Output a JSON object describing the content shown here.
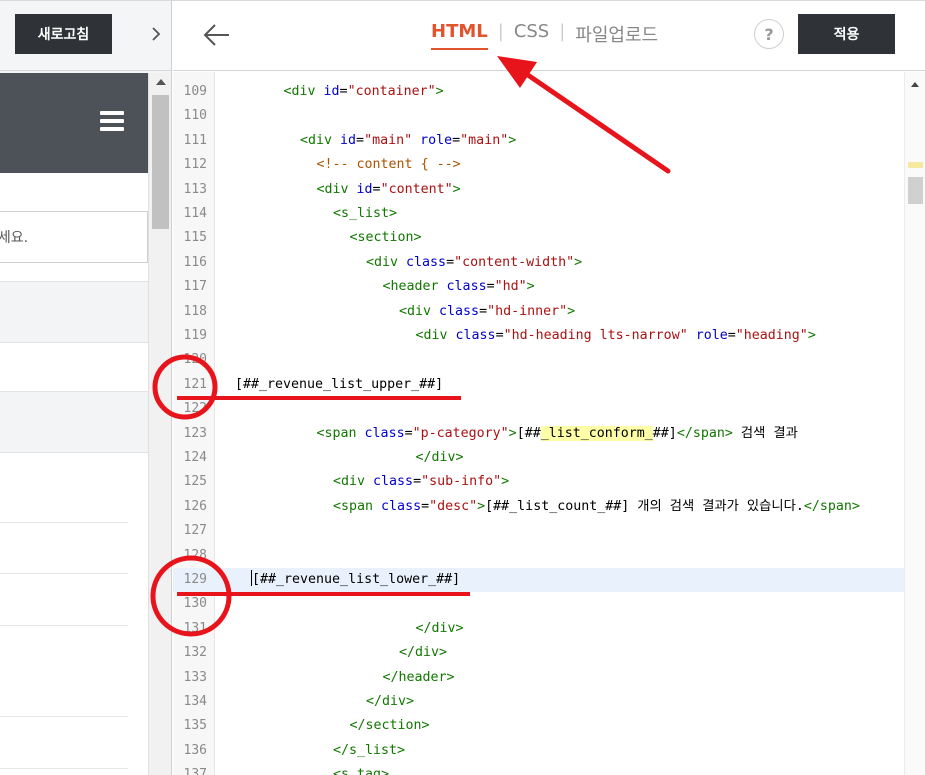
{
  "left_panel": {
    "refresh_label": "새로고침",
    "collapse_icon": "chevron-right-icon",
    "preview": {
      "menu_icon": "hamburger-menu-icon",
      "search_placeholder_fragment": "르세요."
    }
  },
  "toolbar": {
    "back_icon": "arrow-left-icon",
    "tabs": [
      {
        "label": "HTML",
        "active": true
      },
      {
        "label": "CSS",
        "active": false
      },
      {
        "label": "파일업로드",
        "active": false
      }
    ],
    "help_label": "?",
    "apply_label": "적용"
  },
  "colors": {
    "accent": "#e2542e",
    "annotation_red": "#e8141c",
    "dark_button": "#2f3237",
    "preview_header": "#4c5258"
  },
  "editor": {
    "active_line": 129,
    "lines": [
      {
        "n": "109",
        "indent": 1,
        "tokens": [
          [
            "tg",
            "<div "
          ],
          [
            "at",
            "id"
          ],
          [
            "p",
            "="
          ],
          [
            "vl",
            "\"container\""
          ],
          [
            "tg",
            ">"
          ]
        ]
      },
      {
        "n": "110",
        "indent": 0,
        "tokens": []
      },
      {
        "n": "111",
        "indent": 2,
        "tokens": [
          [
            "tg",
            "<div "
          ],
          [
            "at",
            "id"
          ],
          [
            "p",
            "="
          ],
          [
            "vl",
            "\"main\""
          ],
          [
            "p",
            " "
          ],
          [
            "at",
            "role"
          ],
          [
            "p",
            "="
          ],
          [
            "vl",
            "\"main\""
          ],
          [
            "tg",
            ">"
          ]
        ]
      },
      {
        "n": "112",
        "indent": 3,
        "tokens": [
          [
            "cm",
            "<!-- content { -->"
          ]
        ]
      },
      {
        "n": "113",
        "indent": 3,
        "tokens": [
          [
            "tg",
            "<div "
          ],
          [
            "at",
            "id"
          ],
          [
            "p",
            "="
          ],
          [
            "vl",
            "\"content\""
          ],
          [
            "tg",
            ">"
          ]
        ]
      },
      {
        "n": "114",
        "indent": 4,
        "tokens": [
          [
            "tg",
            "<s_list>"
          ]
        ]
      },
      {
        "n": "115",
        "indent": 5,
        "tokens": [
          [
            "tg",
            "<section>"
          ]
        ]
      },
      {
        "n": "116",
        "indent": 6,
        "tokens": [
          [
            "tg",
            "<div "
          ],
          [
            "at",
            "class"
          ],
          [
            "p",
            "="
          ],
          [
            "vl",
            "\"content-width\""
          ],
          [
            "tg",
            ">"
          ]
        ]
      },
      {
        "n": "117",
        "indent": 7,
        "tokens": [
          [
            "tg",
            "<header "
          ],
          [
            "at",
            "class"
          ],
          [
            "p",
            "="
          ],
          [
            "vl",
            "\"hd\""
          ],
          [
            "tg",
            ">"
          ]
        ]
      },
      {
        "n": "118",
        "indent": 8,
        "tokens": [
          [
            "tg",
            "<div "
          ],
          [
            "at",
            "class"
          ],
          [
            "p",
            "="
          ],
          [
            "vl",
            "\"hd-inner\""
          ],
          [
            "tg",
            ">"
          ]
        ]
      },
      {
        "n": "119",
        "indent": 9,
        "tokens": [
          [
            "tg",
            "<div "
          ],
          [
            "at",
            "class"
          ],
          [
            "p",
            "="
          ],
          [
            "vl",
            "\"hd-heading lts-narrow\""
          ],
          [
            "p",
            " "
          ],
          [
            "at",
            "role"
          ],
          [
            "p",
            "="
          ],
          [
            "vl",
            "\"heading\""
          ],
          [
            "tg",
            ">"
          ]
        ]
      },
      {
        "n": "120",
        "indent": 0,
        "tokens": []
      },
      {
        "n": "121",
        "indent": -1,
        "tokens": [
          [
            "p",
            "[##_revenue_list_upper_##]"
          ]
        ]
      },
      {
        "n": "122",
        "indent": 0,
        "tokens": []
      },
      {
        "n": "123",
        "indent": 3,
        "tokens": [
          [
            "tg",
            "<span "
          ],
          [
            "at",
            "class"
          ],
          [
            "p",
            "="
          ],
          [
            "vl",
            "\"p-category\""
          ],
          [
            "tg",
            ">"
          ],
          [
            "p",
            "[##"
          ],
          [
            "hl",
            "_list_conform_"
          ],
          [
            "p",
            "##]"
          ],
          [
            "tg",
            "</span>"
          ],
          [
            "p",
            " 검색 결과"
          ]
        ]
      },
      {
        "n": "124",
        "indent": 9,
        "tokens": [
          [
            "tg",
            "</div>"
          ]
        ]
      },
      {
        "n": "125",
        "indent": 4,
        "tokens": [
          [
            "tg",
            "<div "
          ],
          [
            "at",
            "class"
          ],
          [
            "p",
            "="
          ],
          [
            "vl",
            "\"sub-info\""
          ],
          [
            "tg",
            ">"
          ]
        ]
      },
      {
        "n": "126",
        "indent": 4,
        "tokens": [
          [
            "tg",
            "<span "
          ],
          [
            "at",
            "class"
          ],
          [
            "p",
            "="
          ],
          [
            "vl",
            "\"desc\""
          ],
          [
            "tg",
            ">"
          ],
          [
            "p",
            "[##_list_count_##] 개의 검색 결과가 있습니다."
          ],
          [
            "tg",
            "</span>"
          ]
        ]
      },
      {
        "n": "127",
        "indent": 0,
        "tokens": []
      },
      {
        "n": "128",
        "indent": 0,
        "tokens": []
      },
      {
        "n": "129",
        "indent": -2,
        "tokens": [
          [
            "cur",
            ""
          ],
          [
            "p",
            "[##_revenue_list_lower_##]"
          ]
        ]
      },
      {
        "n": "130",
        "indent": 0,
        "tokens": []
      },
      {
        "n": "131",
        "indent": 9,
        "tokens": [
          [
            "tg",
            "</div>"
          ]
        ]
      },
      {
        "n": "132",
        "indent": 8,
        "tokens": [
          [
            "tg",
            "</div>"
          ]
        ]
      },
      {
        "n": "133",
        "indent": 7,
        "tokens": [
          [
            "tg",
            "</header>"
          ]
        ]
      },
      {
        "n": "134",
        "indent": 6,
        "tokens": [
          [
            "tg",
            "</div>"
          ]
        ]
      },
      {
        "n": "135",
        "indent": 5,
        "tokens": [
          [
            "tg",
            "</section>"
          ]
        ]
      },
      {
        "n": "136",
        "indent": 4,
        "tokens": [
          [
            "tg",
            "</s_list>"
          ]
        ]
      },
      {
        "n": "137",
        "indent": 4,
        "tokens": [
          [
            "tg",
            "<s_tag>"
          ]
        ]
      }
    ]
  }
}
